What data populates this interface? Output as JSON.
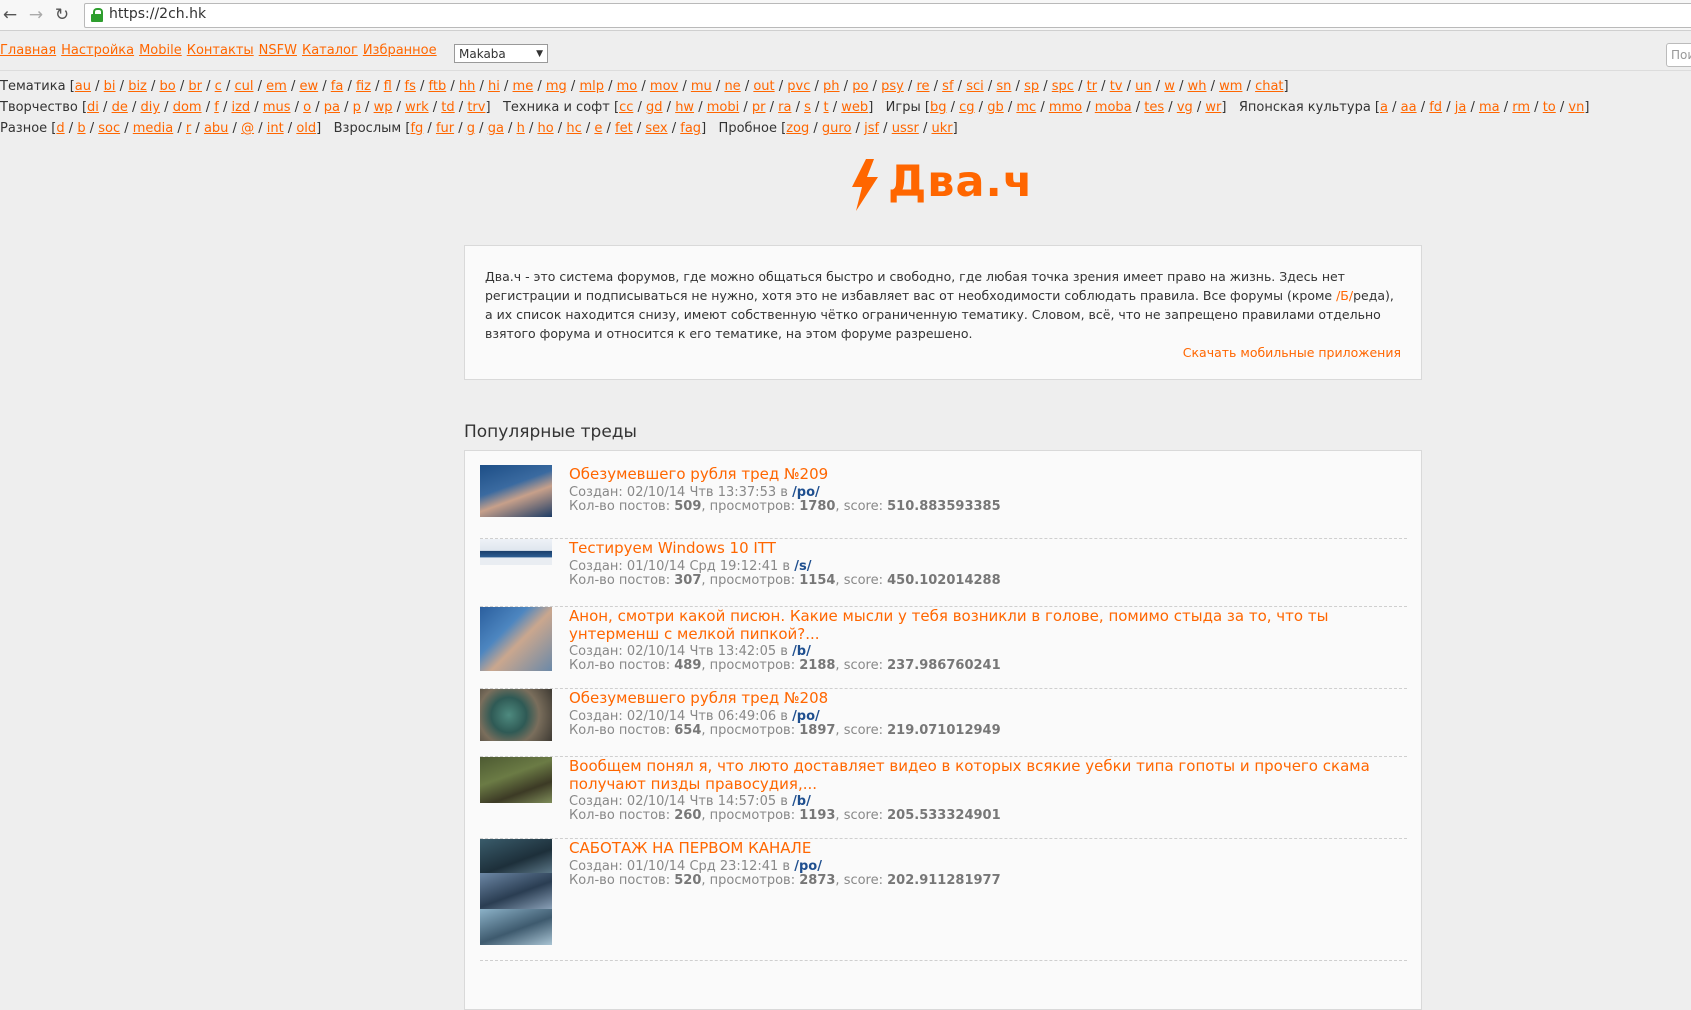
{
  "browser": {
    "url": "https://2ch.hk",
    "back_icon": "←",
    "forward_icon": "→",
    "reload_icon": "↻"
  },
  "topmenu": {
    "items": [
      "Главная",
      "Настройка",
      "Mobile",
      "Контакты",
      "NSFW",
      "Каталог",
      "Избранное"
    ],
    "style_select": "Makaba",
    "search_placeholder": "Пои"
  },
  "boards": {
    "rows": [
      [
        {
          "name": "Тематика",
          "links": [
            "au",
            "bi",
            "biz",
            "bo",
            "br",
            "c",
            "cul",
            "em",
            "ew",
            "fa",
            "fiz",
            "fl",
            "fs",
            "ftb",
            "hh",
            "hi",
            "me",
            "mg",
            "mlp",
            "mo",
            "mov",
            "mu",
            "ne",
            "out",
            "pvc",
            "ph",
            "po",
            "psy",
            "re",
            "sf",
            "sci",
            "sn",
            "sp",
            "spc",
            "tr",
            "tv",
            "un",
            "w",
            "wh",
            "wm",
            "chat"
          ]
        }
      ],
      [
        {
          "name": "Творчество",
          "links": [
            "di",
            "de",
            "diy",
            "dom",
            "f",
            "izd",
            "mus",
            "o",
            "pa",
            "p",
            "wp",
            "wrk",
            "td",
            "trv"
          ]
        },
        {
          "name": "Техника и софт",
          "links": [
            "cc",
            "gd",
            "hw",
            "mobi",
            "pr",
            "ra",
            "s",
            "t",
            "web"
          ]
        },
        {
          "name": "Игры",
          "links": [
            "bg",
            "cg",
            "gb",
            "mc",
            "mmo",
            "moba",
            "tes",
            "vg",
            "wr"
          ]
        },
        {
          "name": "Японская культура",
          "links": [
            "a",
            "aa",
            "fd",
            "ja",
            "ma",
            "rm",
            "to",
            "vn"
          ]
        }
      ],
      [
        {
          "name": "Разное",
          "links": [
            "d",
            "b",
            "soc",
            "media",
            "r",
            "abu",
            "@",
            "int",
            "old"
          ]
        },
        {
          "name": "Взрослым",
          "links": [
            "fg",
            "fur",
            "g",
            "ga",
            "h",
            "ho",
            "hc",
            "e",
            "fet",
            "sex",
            "fag"
          ]
        },
        {
          "name": "Пробное",
          "links": [
            "zog",
            "guro",
            "jsf",
            "ussr",
            "ukr"
          ]
        }
      ]
    ]
  },
  "logo": {
    "text": "Два.ч",
    "color": "#ff6600"
  },
  "about": {
    "text_before": "Два.ч - это система форумов, где можно общаться быстро и свободно, где любая точка зрения имеет право на жизнь. Здесь нет регистрации и подписываться не нужно, хотя это не избавляет вас от необходимости соблюдать правила. Все форумы (кроме ",
    "b_link": "/Б/",
    "text_after": "реда), а их список находится снизу, имеют собственную чётко ограниченную тематику. Словом, всё, что не запрещено правилами отдельно взятого форума и относится к его тематике, на этом форуме разрешено.",
    "apps_link": "Скачать мобильные приложения"
  },
  "popular": {
    "title": "Популярные треды",
    "created_label": "Создан:",
    "in_label": "в",
    "posts_label": "Кол-во постов:",
    "views_label": "просмотров:",
    "score_label": "score:",
    "threads": [
      {
        "title": "Обезумевшего рубля тред №209",
        "date": "02/10/14 Чтв 13:37:53",
        "board": "/po/",
        "posts": "509",
        "views": "1780",
        "score": "510.883593385"
      },
      {
        "title": "Тестируем Windows 10 ITT",
        "date": "01/10/14 Срд 19:12:41",
        "board": "/s/",
        "posts": "307",
        "views": "1154",
        "score": "450.102014288"
      },
      {
        "title": "Анон, смотри какой писюн. Какие мысли у тебя возникли в голове, помимо стыда за то, что ты унтерменш с мелкой пипкой?...",
        "date": "02/10/14 Чтв 13:42:05",
        "board": "/b/",
        "posts": "489",
        "views": "2188",
        "score": "237.986760241"
      },
      {
        "title": "Обезумевшего рубля тред №208",
        "date": "02/10/14 Чтв 06:49:06",
        "board": "/po/",
        "posts": "654",
        "views": "1897",
        "score": "219.071012949"
      },
      {
        "title": "Вообщем понял я, что люто доставляет видео в которых всякие уебки типа гопоты и прочего скама получают пизды правосудия,...",
        "date": "02/10/14 Чтв 14:57:05",
        "board": "/b/",
        "posts": "260",
        "views": "1193",
        "score": "205.533324901"
      },
      {
        "title": "САБОТАЖ НА ПЕРВОМ КАНАЛЕ",
        "date": "01/10/14 Срд 23:12:41",
        "board": "/po/",
        "posts": "520",
        "views": "2873",
        "score": "202.911281977"
      }
    ]
  }
}
